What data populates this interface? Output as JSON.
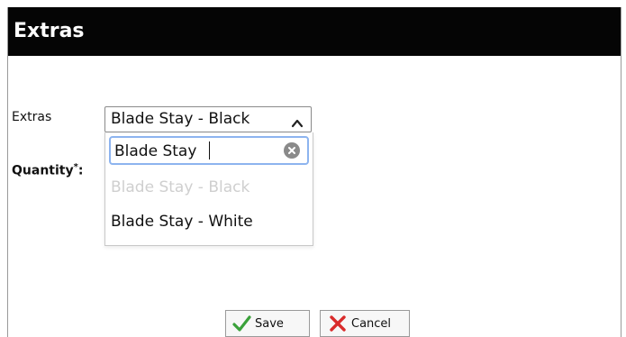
{
  "dialog": {
    "title": "Extras"
  },
  "form": {
    "extras_label": "Extras",
    "quantity_label": "Quantity",
    "quantity_required_marker": "*",
    "quantity_colon": ":",
    "extras_selected": "Blade Stay - Black",
    "search_value": "Blade Stay",
    "options": [
      {
        "label": "Blade Stay - Black",
        "disabled": true
      },
      {
        "label": "Blade Stay - White",
        "disabled": false
      }
    ]
  },
  "buttons": {
    "save_label": "Save",
    "cancel_label": "Cancel"
  },
  "icons": {
    "select_chevron": "chevron-up-icon",
    "clear_search": "clear-circle-icon",
    "save": "checkmark-icon",
    "cancel": "red-x-icon"
  },
  "colors": {
    "titlebar_bg": "#050505",
    "search_focus_border": "#8db4ef",
    "disabled_option": "#cfcfcf",
    "save_check": "#3aa13a",
    "cancel_x": "#d92b2b"
  }
}
